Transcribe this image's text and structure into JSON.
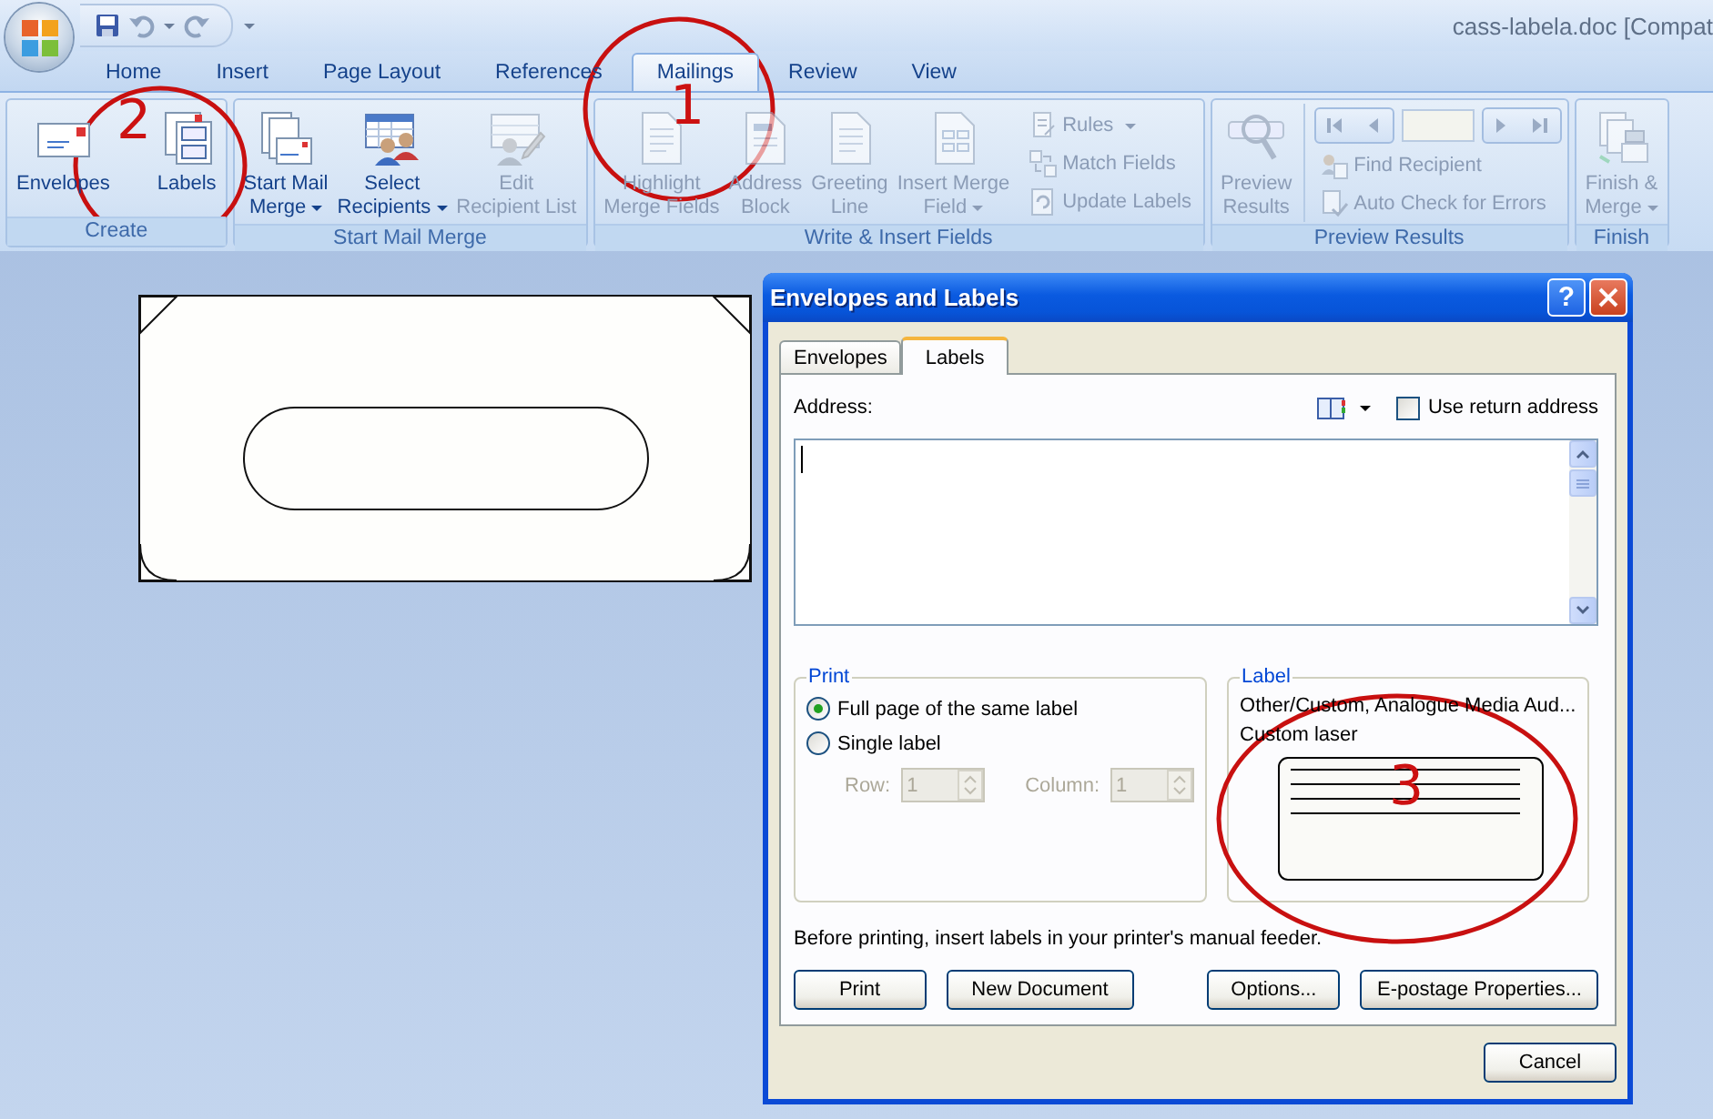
{
  "title_bar": {
    "title": "cass-labela.doc [Compat"
  },
  "ribbon_tabs": [
    {
      "label": "Home",
      "selected": false
    },
    {
      "label": "Insert",
      "selected": false
    },
    {
      "label": "Page Layout",
      "selected": false
    },
    {
      "label": "References",
      "selected": false
    },
    {
      "label": "Mailings",
      "selected": true
    },
    {
      "label": "Review",
      "selected": false
    },
    {
      "label": "View",
      "selected": false
    }
  ],
  "ribbon_groups": [
    {
      "title": "Create",
      "items": [
        {
          "kind": "large",
          "label": "Envelopes",
          "dropdown": false,
          "disabled": false
        },
        {
          "kind": "large",
          "label": "Labels",
          "dropdown": false,
          "disabled": false
        }
      ]
    },
    {
      "title": "Start Mail Merge",
      "items": [
        {
          "kind": "large",
          "label": "Start Mail\nMerge",
          "dropdown": true,
          "disabled": false
        },
        {
          "kind": "large",
          "label": "Select\nRecipients",
          "dropdown": true,
          "disabled": false
        },
        {
          "kind": "large",
          "label": "Edit\nRecipient List",
          "dropdown": false,
          "disabled": true
        }
      ]
    },
    {
      "title": "Write & Insert Fields",
      "items": [
        {
          "kind": "large",
          "label": "Highlight\nMerge Fields",
          "dropdown": false,
          "disabled": true
        },
        {
          "kind": "large",
          "label": "Address\nBlock",
          "dropdown": false,
          "disabled": true
        },
        {
          "kind": "large",
          "label": "Greeting\nLine",
          "dropdown": false,
          "disabled": true
        },
        {
          "kind": "large",
          "label": "Insert Merge\nField",
          "dropdown": true,
          "disabled": true
        },
        {
          "kind": "stack",
          "items": [
            {
              "label": "Rules",
              "dropdown": true,
              "disabled": true
            },
            {
              "label": "Match Fields",
              "dropdown": false,
              "disabled": true
            },
            {
              "label": "Update Labels",
              "dropdown": false,
              "disabled": true
            }
          ]
        }
      ]
    },
    {
      "title": "Preview Results",
      "items": [
        {
          "kind": "large",
          "label": "Preview\nResults",
          "dropdown": false,
          "disabled": true
        },
        {
          "kind": "navigator",
          "items": [
            {
              "label": "Find Recipient",
              "dropdown": false,
              "disabled": true
            },
            {
              "label": "Auto Check for Errors",
              "dropdown": false,
              "disabled": true
            }
          ]
        }
      ]
    },
    {
      "title": "Finish",
      "items": [
        {
          "kind": "large",
          "label": "Finish &\nMerge",
          "dropdown": true,
          "disabled": true
        }
      ]
    }
  ],
  "dialog": {
    "title": "Envelopes and Labels",
    "help": "?",
    "tabs": [
      {
        "label": "Envelopes",
        "selected": false
      },
      {
        "label": "Labels",
        "selected": true
      }
    ],
    "address_label": "Address:",
    "use_return_address": {
      "label": "Use return address",
      "checked": false
    },
    "print_group": {
      "title": "Print",
      "options": [
        {
          "label": "Full page of the same label",
          "selected": true
        },
        {
          "label": "Single label",
          "selected": false
        }
      ],
      "row": {
        "label": "Row:",
        "value": "1",
        "disabled": true
      },
      "column": {
        "label": "Column:",
        "value": "1",
        "disabled": true
      }
    },
    "label_group": {
      "title": "Label",
      "vendor": "Other/Custom, Analogue Media Aud...",
      "product": "Custom laser"
    },
    "note": "Before printing, insert labels in your printer's manual feeder.",
    "buttons": [
      {
        "label": "Print"
      },
      {
        "label": "New Document"
      },
      {
        "label": "Options..."
      },
      {
        "label": "E-postage Properties..."
      }
    ],
    "cancel": "Cancel"
  },
  "annotations": [
    {
      "number": "2"
    },
    {
      "number": "1"
    },
    {
      "number": "3"
    }
  ]
}
